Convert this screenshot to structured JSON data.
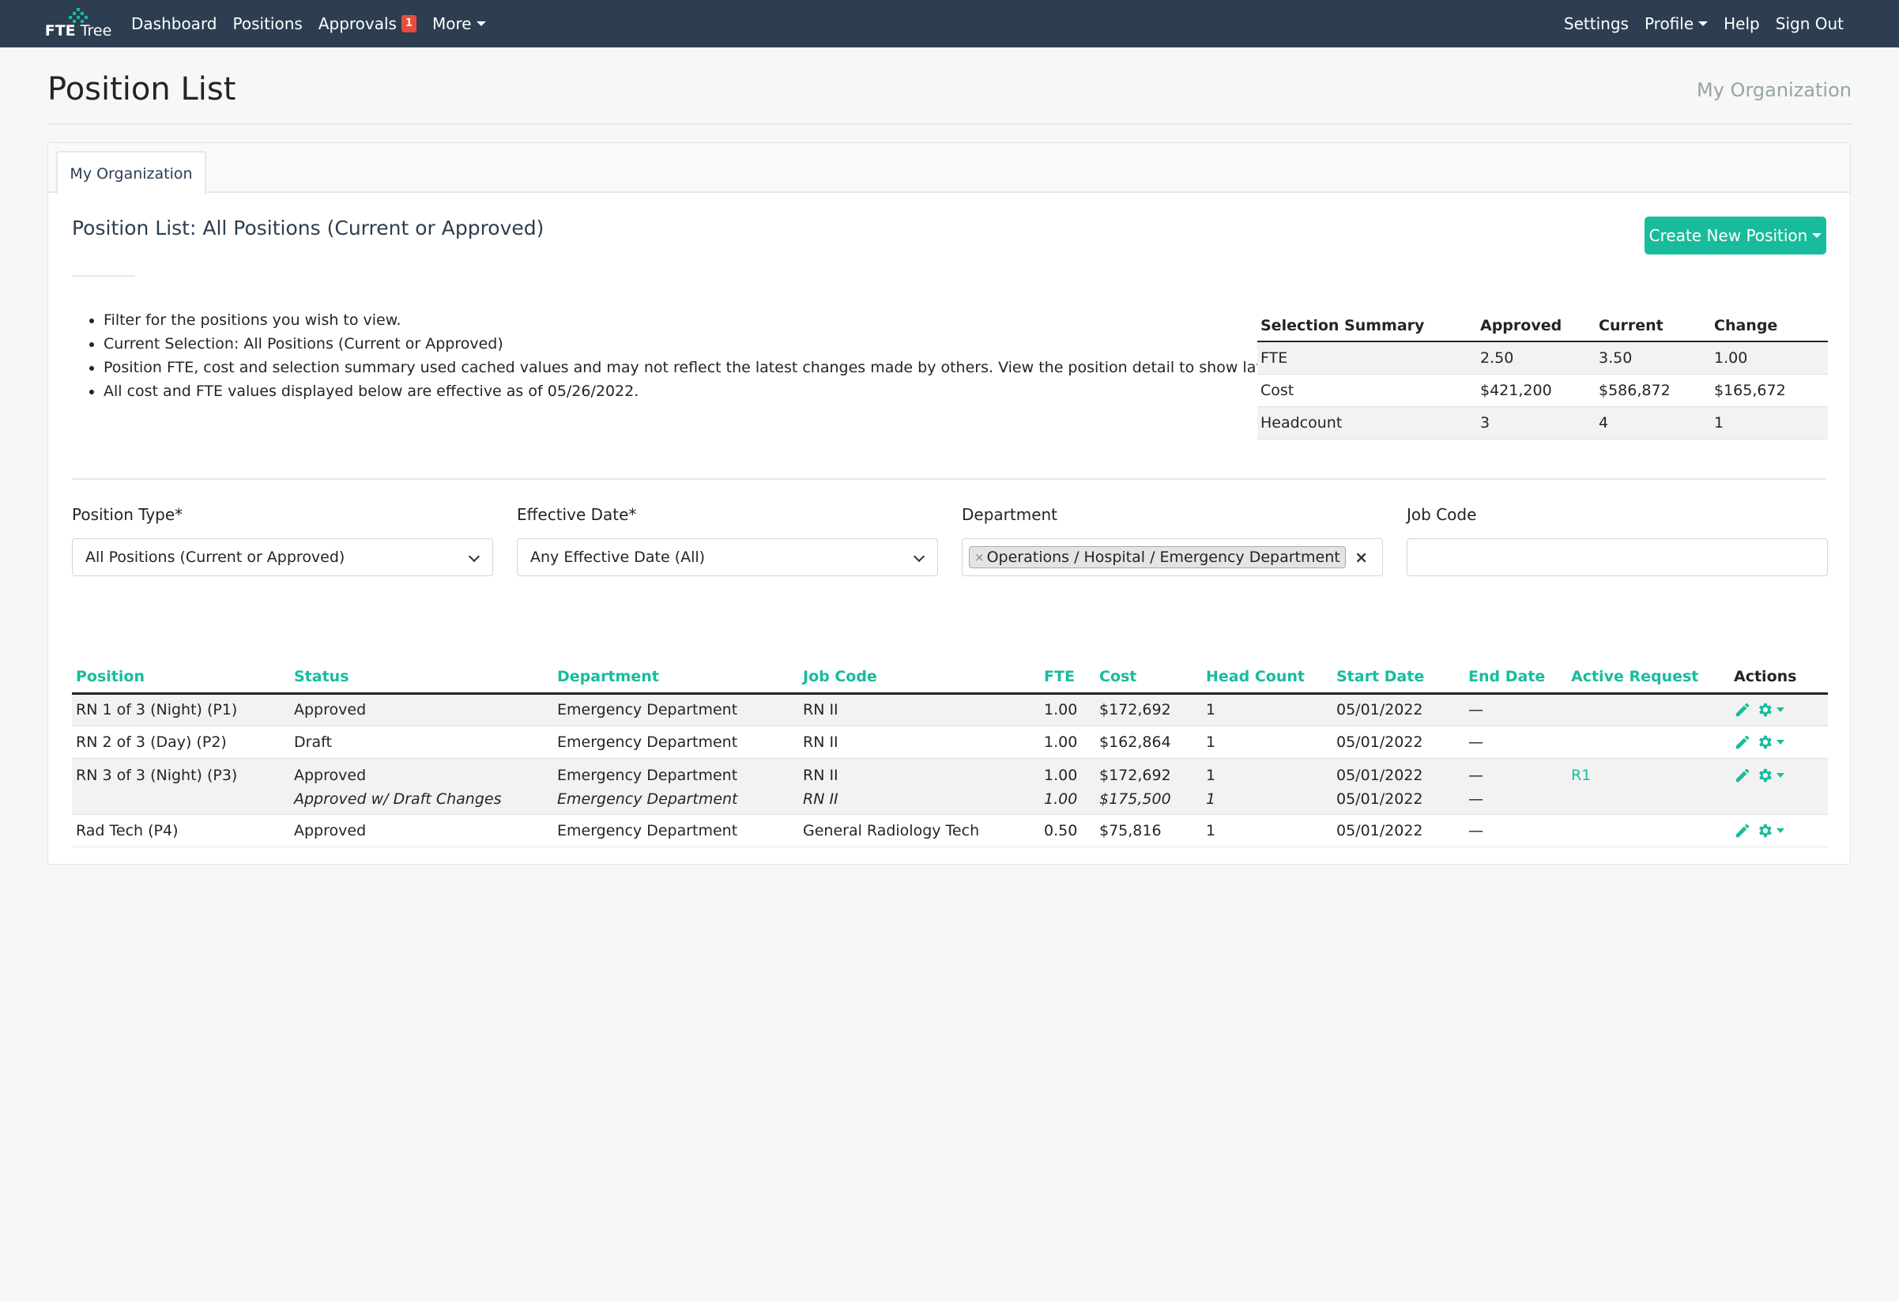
{
  "navbar": {
    "logo_primary": "FTE",
    "logo_secondary": "Tree",
    "links": {
      "dashboard": "Dashboard",
      "positions": "Positions",
      "approvals": "Approvals",
      "approvals_badge": "1",
      "more": "More"
    },
    "right_links": {
      "settings": "Settings",
      "profile": "Profile",
      "help": "Help",
      "sign_out": "Sign Out"
    }
  },
  "header": {
    "title": "Position List",
    "org_name": "My Organization"
  },
  "tabs": [
    {
      "label": "My Organization"
    }
  ],
  "section": {
    "title": "Position List: All Positions (Current or Approved)",
    "create_button": "Create New Position"
  },
  "notes": [
    "Filter for the positions you wish to view.",
    "Current Selection: All Positions (Current or Approved)",
    "Position FTE, cost and selection summary used cached values and may not reflect the latest changes made by others. View the position detail to show latest data.",
    "All cost and FTE values displayed below are effective as of 05/26/2022."
  ],
  "summary": {
    "headers": [
      "Selection Summary",
      "Approved",
      "Current",
      "Change"
    ],
    "rows": [
      [
        "FTE",
        "2.50",
        "3.50",
        "1.00"
      ],
      [
        "Cost",
        "$421,200",
        "$586,872",
        "$165,672"
      ],
      [
        "Headcount",
        "3",
        "4",
        "1"
      ]
    ]
  },
  "filters": {
    "position_type": {
      "label": "Position Type*",
      "value": "All Positions (Current or Approved)"
    },
    "effective_date": {
      "label": "Effective Date*",
      "value": "Any Effective Date (All)"
    },
    "department": {
      "label": "Department",
      "tag": "Operations / Hospital / Emergency Department",
      "tag_remove": "×",
      "clear": "×"
    },
    "job_code": {
      "label": "Job Code",
      "value": ""
    }
  },
  "table": {
    "headers": [
      "Position",
      "Status",
      "Department",
      "Job Code",
      "FTE",
      "Cost",
      "Head Count",
      "Start Date",
      "End Date",
      "Active Request",
      "Actions"
    ],
    "rows": [
      {
        "position": "RN 1 of 3 (Night) (P1)",
        "status": "Approved",
        "department": "Emergency Department",
        "job_code": "RN II",
        "fte": "1.00",
        "cost": "$172,692",
        "head_count": "1",
        "start_date": "05/01/2022",
        "end_date": "—",
        "active_request": ""
      },
      {
        "position": "RN 2 of 3 (Day) (P2)",
        "status": "Draft",
        "department": "Emergency Department",
        "job_code": "RN II",
        "fte": "1.00",
        "cost": "$162,864",
        "head_count": "1",
        "start_date": "05/01/2022",
        "end_date": "—",
        "active_request": ""
      },
      {
        "position": "RN 3 of 3 (Night) (P3)",
        "status": "Approved",
        "department": "Emergency Department",
        "job_code": "RN II",
        "fte": "1.00",
        "cost": "$172,692",
        "head_count": "1",
        "start_date": "05/01/2022",
        "end_date": "—",
        "active_request": "R1",
        "draft": {
          "status": "Approved w/ Draft Changes",
          "department": "Emergency Department",
          "job_code": "RN II",
          "fte": "1.00",
          "cost": "$175,500",
          "head_count": "1",
          "start_date": "05/01/2022",
          "end_date": "—"
        }
      },
      {
        "position": "Rad Tech (P4)",
        "status": "Approved",
        "department": "Emergency Department",
        "job_code": "General Radiology Tech",
        "fte": "0.50",
        "cost": "$75,816",
        "head_count": "1",
        "start_date": "05/01/2022",
        "end_date": "—",
        "active_request": ""
      }
    ]
  },
  "colors": {
    "navbar": "#2c3e50",
    "accent": "#18bc9c",
    "badge": "#e74c3c"
  },
  "icons": {
    "edit": "pencil-icon",
    "settings": "gear-icon"
  }
}
